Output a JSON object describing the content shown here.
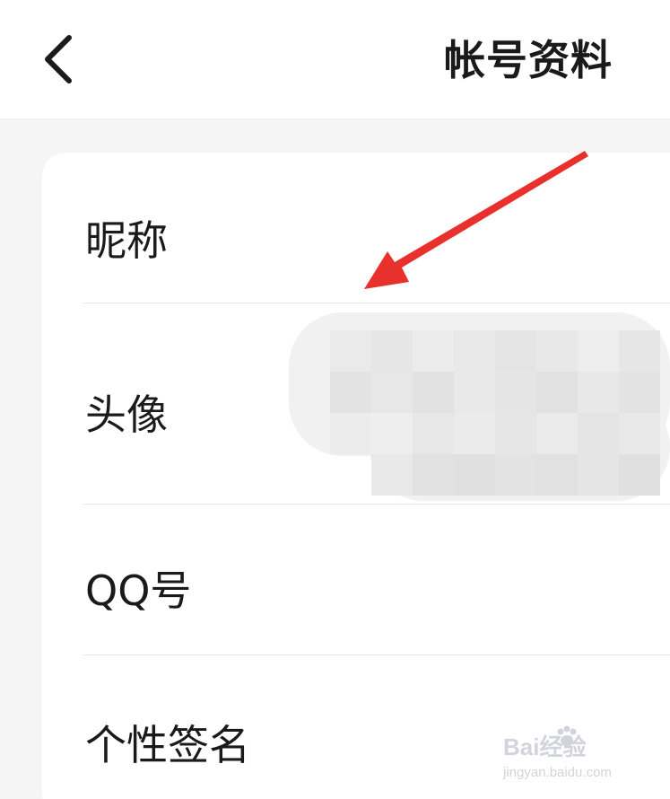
{
  "header": {
    "back_icon": "chevron-left-icon",
    "title": "帐号资料"
  },
  "profile_rows": [
    {
      "label": "昵称"
    },
    {
      "label": "头像"
    },
    {
      "label": "QQ号"
    },
    {
      "label": "个性签名"
    }
  ],
  "annotation": {
    "icon": "red-arrow-icon",
    "color": "#e8302c"
  },
  "watermark": {
    "brand": "Bai经验",
    "url": "jingyan.baidu.com"
  },
  "colors": {
    "page_background": "#f5f5f5",
    "card_background": "#ffffff",
    "text": "#1a1a1a",
    "divider": "#e6e6e6"
  }
}
